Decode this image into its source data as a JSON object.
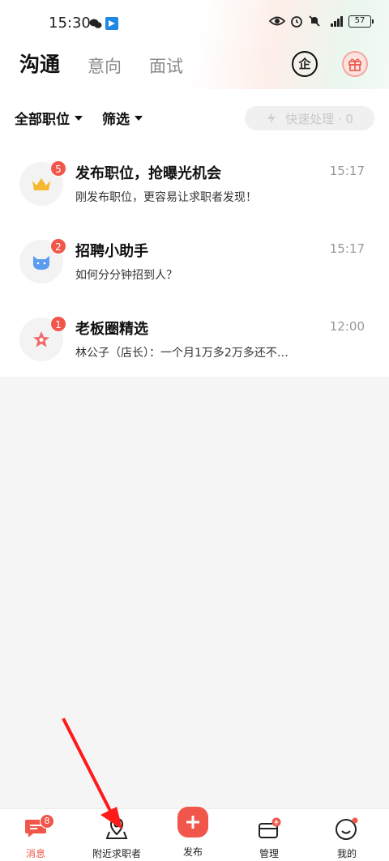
{
  "status_bar": {
    "time": "15:30",
    "battery": "57"
  },
  "header": {
    "tabs": [
      {
        "label": "沟通",
        "active": true
      },
      {
        "label": "意向",
        "active": false
      },
      {
        "label": "面试",
        "active": false
      }
    ],
    "company_icon_char": "企"
  },
  "filters": {
    "position_label": "全部职位",
    "filter_label": "筛选",
    "quick_process_label": "快速处理 · 0"
  },
  "messages": [
    {
      "title": "发布职位，抢曝光机会",
      "preview": "刚发布职位，更容易让求职者发现！",
      "time": "15:17",
      "badge": "5",
      "icon": "crown-icon"
    },
    {
      "title": "招聘小助手",
      "preview": "如何分分钟招到人？",
      "time": "15:17",
      "badge": "2",
      "icon": "cat-icon"
    },
    {
      "title": "老板圈精选",
      "preview": "林公子（店长）：一个月1万多2万多还不…",
      "time": "12:00",
      "badge": "1",
      "icon": "star-icon"
    }
  ],
  "bottom_nav": {
    "items": [
      {
        "label": "消息",
        "badge": "8",
        "active": true
      },
      {
        "label": "附近求职者",
        "active": false
      },
      {
        "label": "发布",
        "active": false
      },
      {
        "label": "管理",
        "active": false
      },
      {
        "label": "我的",
        "active": false
      }
    ]
  },
  "colors": {
    "accent": "#f0574a",
    "arrow": "#ff1a1a"
  }
}
